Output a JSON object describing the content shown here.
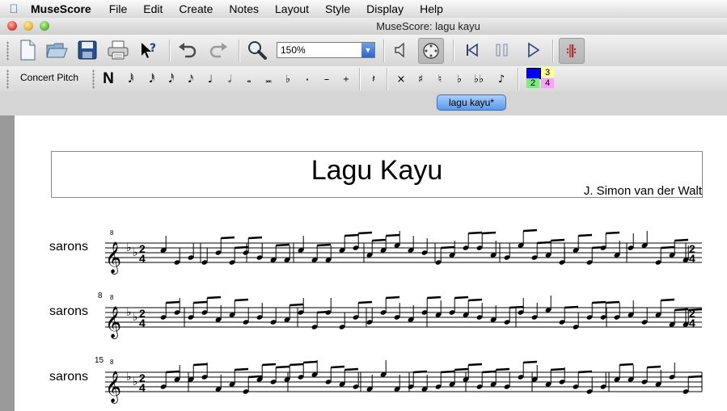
{
  "menubar": {
    "app": "MuseScore",
    "items": [
      "File",
      "Edit",
      "Create",
      "Notes",
      "Layout",
      "Style",
      "Display",
      "Help"
    ]
  },
  "window": {
    "title": "MuseScore: lagu kayu"
  },
  "toolbar": {
    "zoom_value": "150%",
    "icons": [
      "new-file-icon",
      "open-file-icon",
      "save-icon",
      "print-icon",
      "whats-this-icon",
      "undo-icon",
      "redo-icon",
      "zoom-icon",
      "speaker-icon",
      "play-panel-icon",
      "rewind-icon",
      "pause-icon",
      "play-icon",
      "repeat-icon"
    ]
  },
  "notes_toolbar": {
    "concert_pitch": "Concert Pitch",
    "note_input": "N",
    "voices": [
      "1",
      "2",
      "3",
      "4"
    ],
    "voice_colors": [
      "#0000ff",
      "#00c000",
      "#ffff80",
      "#ff80ff"
    ]
  },
  "tab": {
    "label": "lagu kayu*"
  },
  "score": {
    "title": "Lagu Kayu",
    "composer": "J. Simon van der Walt",
    "systems": [
      {
        "instrument": "sarons",
        "measure_number": "",
        "time_sig_top": "2",
        "time_sig_bottom": "4"
      },
      {
        "instrument": "sarons",
        "measure_number": "8",
        "time_sig_top": "2",
        "time_sig_bottom": "4"
      },
      {
        "instrument": "sarons",
        "measure_number": "15",
        "time_sig_top": "2",
        "time_sig_bottom": "4"
      }
    ],
    "clef_octave_mark": "8"
  },
  "colors": {
    "tab_accent": "#5a9ae8",
    "zoom_arrow": "#2d63c8"
  }
}
